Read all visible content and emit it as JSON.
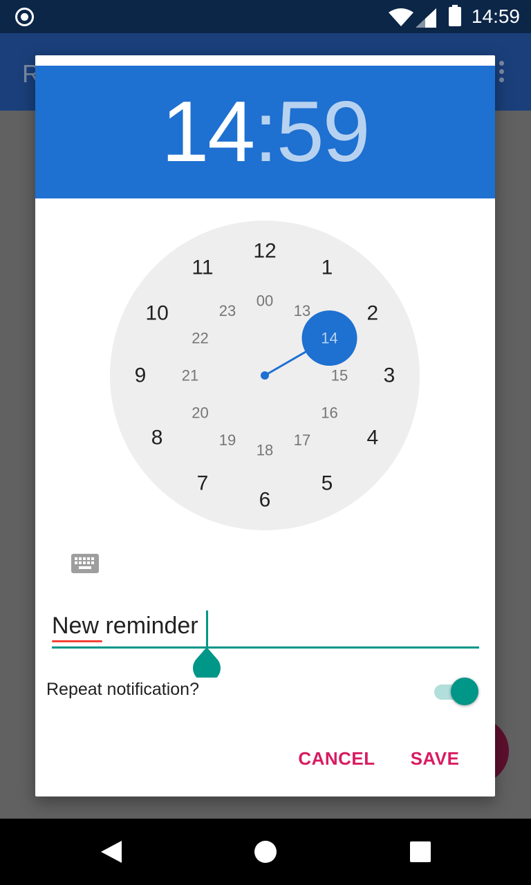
{
  "status_bar": {
    "time": "14:59"
  },
  "app_bar": {
    "title_partial": "R"
  },
  "time_picker": {
    "hour": "14",
    "separator": ":",
    "minute": "59",
    "selected_hour": "14",
    "outer_numbers": [
      "12",
      "1",
      "2",
      "3",
      "4",
      "5",
      "6",
      "7",
      "8",
      "9",
      "10",
      "11"
    ],
    "inner_numbers": [
      "00",
      "13",
      "14",
      "15",
      "16",
      "17",
      "18",
      "19",
      "20",
      "21",
      "22",
      "23"
    ]
  },
  "reminder": {
    "text": "New reminder"
  },
  "repeat": {
    "label": "Repeat notification?",
    "enabled": true
  },
  "actions": {
    "cancel": "CANCEL",
    "save": "SAVE"
  },
  "colors": {
    "header": "#1e70d1",
    "accent": "#009688",
    "button_text": "#d81b60",
    "clock_face": "#eeeeee"
  }
}
